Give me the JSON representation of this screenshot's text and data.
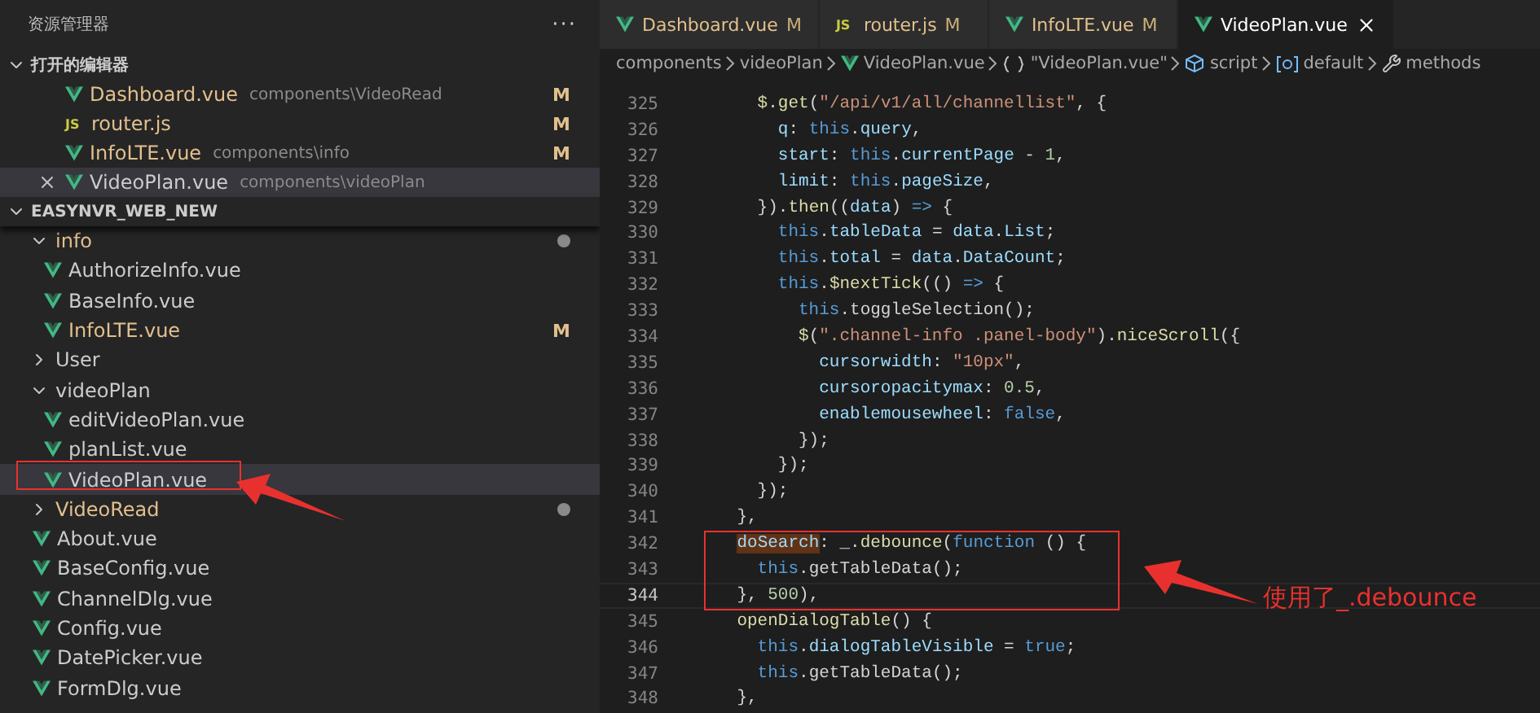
{
  "sidebar": {
    "title": "资源管理器",
    "more": "···",
    "open_editors": {
      "title": "打开的编辑器",
      "expanded": true,
      "items": [
        {
          "name": "Dashboard.vue",
          "path": "components\\VideoRead",
          "kind": "vue",
          "modified": true,
          "badge": "M",
          "active": false
        },
        {
          "name": "router.js",
          "kind": "js",
          "icon_label": "JS",
          "modified": true,
          "badge": "M",
          "active": false
        },
        {
          "name": "InfoLTE.vue",
          "path": "components\\info",
          "kind": "vue",
          "modified": true,
          "badge": "M",
          "active": false
        },
        {
          "name": "VideoPlan.vue",
          "path": "components\\videoPlan",
          "kind": "vue",
          "modified": false,
          "active": true
        }
      ]
    },
    "project": {
      "title": "EASYNVR_WEB_NEW",
      "expanded": true,
      "tree": [
        {
          "kind": "folder",
          "name": "info",
          "expanded": true,
          "changed": true,
          "children": [
            {
              "kind": "file",
              "name": "AuthorizeInfo.vue",
              "modified": false,
              "selected": false
            },
            {
              "kind": "file",
              "name": "BaseInfo.vue",
              "modified": false,
              "selected": false
            },
            {
              "kind": "file",
              "name": "InfoLTE.vue",
              "modified": true,
              "badge": "M",
              "selected": false
            }
          ]
        },
        {
          "kind": "folder",
          "name": "User",
          "expanded": false,
          "changed": false
        },
        {
          "kind": "folder",
          "name": "videoPlan",
          "expanded": true,
          "changed": false,
          "children": [
            {
              "kind": "file",
              "name": "editVideoPlan.vue",
              "modified": false,
              "selected": false
            },
            {
              "kind": "file",
              "name": "planList.vue",
              "modified": false,
              "selected": false
            },
            {
              "kind": "file",
              "name": "VideoPlan.vue",
              "modified": false,
              "selected": true
            }
          ]
        },
        {
          "kind": "folder",
          "name": "VideoRead",
          "expanded": false,
          "changed": true
        },
        {
          "kind": "file",
          "name": "About.vue",
          "modified": false,
          "selected": false
        },
        {
          "kind": "file",
          "name": "BaseConfig.vue",
          "modified": false,
          "selected": false
        },
        {
          "kind": "file",
          "name": "ChannelDlg.vue",
          "modified": false,
          "selected": false
        },
        {
          "kind": "file",
          "name": "Config.vue",
          "modified": false,
          "selected": false
        },
        {
          "kind": "file",
          "name": "DatePicker.vue",
          "modified": false,
          "selected": false
        },
        {
          "kind": "file",
          "name": "FormDlg.vue",
          "modified": false,
          "selected": false
        }
      ]
    }
  },
  "tabs": [
    {
      "label": "Dashboard.vue",
      "kind": "vue",
      "badge": "M",
      "selected": false
    },
    {
      "label": "router.js",
      "kind": "js",
      "icon_label": "JS",
      "badge": "M",
      "selected": false
    },
    {
      "label": "InfoLTE.vue",
      "kind": "vue",
      "badge": "M",
      "selected": false
    },
    {
      "label": "VideoPlan.vue",
      "kind": "vue",
      "selected": true
    }
  ],
  "breadcrumb": [
    {
      "label": "components",
      "kind": "folder"
    },
    {
      "label": "videoPlan",
      "kind": "folder"
    },
    {
      "label": "VideoPlan.vue",
      "kind": "vue"
    },
    {
      "label": "\"VideoPlan.vue\"",
      "kind": "braces"
    },
    {
      "label": "script",
      "kind": "cube"
    },
    {
      "label": "default",
      "kind": "variable"
    },
    {
      "label": "methods",
      "kind": "wrench"
    }
  ],
  "code": [
    {
      "number": "325",
      "current": false,
      "tokens": [
        {
          "kind": "fn",
          "text": "      $"
        },
        {
          "kind": "p",
          "text": "."
        },
        {
          "kind": "fn",
          "text": "get"
        },
        {
          "kind": "p",
          "text": "("
        },
        {
          "kind": "str",
          "text": "\"/api/v1/all/channellist\""
        },
        {
          "kind": "p",
          "text": ", {"
        }
      ]
    },
    {
      "number": "326",
      "current": false,
      "tokens": [
        {
          "kind": "prop",
          "text": "        q"
        },
        {
          "kind": "p",
          "text": ": "
        },
        {
          "kind": "kw",
          "text": "this"
        },
        {
          "kind": "p",
          "text": "."
        },
        {
          "kind": "prop",
          "text": "query"
        },
        {
          "kind": "p",
          "text": ","
        }
      ]
    },
    {
      "number": "327",
      "current": false,
      "tokens": [
        {
          "kind": "prop",
          "text": "        start"
        },
        {
          "kind": "p",
          "text": ": "
        },
        {
          "kind": "kw",
          "text": "this"
        },
        {
          "kind": "p",
          "text": "."
        },
        {
          "kind": "prop",
          "text": "currentPage"
        },
        {
          "kind": "p",
          "text": " - "
        },
        {
          "kind": "num",
          "text": "1"
        },
        {
          "kind": "p",
          "text": ","
        }
      ]
    },
    {
      "number": "328",
      "current": false,
      "tokens": [
        {
          "kind": "prop",
          "text": "        limit"
        },
        {
          "kind": "p",
          "text": ": "
        },
        {
          "kind": "kw",
          "text": "this"
        },
        {
          "kind": "p",
          "text": "."
        },
        {
          "kind": "prop",
          "text": "pageSize"
        },
        {
          "kind": "p",
          "text": ","
        }
      ]
    },
    {
      "number": "329",
      "current": false,
      "tokens": [
        {
          "kind": "p",
          "text": "      })."
        },
        {
          "kind": "fn",
          "text": "then"
        },
        {
          "kind": "p",
          "text": "(("
        },
        {
          "kind": "prop",
          "text": "data"
        },
        {
          "kind": "p",
          "text": ") "
        },
        {
          "kind": "kw",
          "text": "=>"
        },
        {
          "kind": "p",
          "text": " {"
        }
      ]
    },
    {
      "number": "330",
      "current": false,
      "tokens": [
        {
          "kind": "kw",
          "text": "        this"
        },
        {
          "kind": "p",
          "text": "."
        },
        {
          "kind": "prop",
          "text": "tableData"
        },
        {
          "kind": "p",
          "text": " = "
        },
        {
          "kind": "prop",
          "text": "data"
        },
        {
          "kind": "p",
          "text": "."
        },
        {
          "kind": "prop",
          "text": "List"
        },
        {
          "kind": "p",
          "text": ";"
        }
      ]
    },
    {
      "number": "331",
      "current": false,
      "tokens": [
        {
          "kind": "kw",
          "text": "        this"
        },
        {
          "kind": "p",
          "text": "."
        },
        {
          "kind": "prop",
          "text": "total"
        },
        {
          "kind": "p",
          "text": " = "
        },
        {
          "kind": "prop",
          "text": "data"
        },
        {
          "kind": "p",
          "text": "."
        },
        {
          "kind": "prop",
          "text": "DataCount"
        },
        {
          "kind": "p",
          "text": ";"
        }
      ]
    },
    {
      "number": "332",
      "current": false,
      "tokens": [
        {
          "kind": "kw",
          "text": "        this"
        },
        {
          "kind": "p",
          "text": "."
        },
        {
          "kind": "fn",
          "text": "$nextTick"
        },
        {
          "kind": "p",
          "text": "(() "
        },
        {
          "kind": "kw",
          "text": "=>"
        },
        {
          "kind": "p",
          "text": " {"
        }
      ]
    },
    {
      "number": "333",
      "current": false,
      "tokens": [
        {
          "kind": "kw",
          "text": "          this"
        },
        {
          "kind": "p",
          "text": ".toggleSelection"
        },
        {
          "kind": "p",
          "text": "();"
        }
      ]
    },
    {
      "number": "334",
      "current": false,
      "tokens": [
        {
          "kind": "fn",
          "text": "          $"
        },
        {
          "kind": "p",
          "text": "("
        },
        {
          "kind": "str",
          "text": "\".channel-info .panel-body\""
        },
        {
          "kind": "p",
          "text": ")."
        },
        {
          "kind": "fn",
          "text": "niceScroll"
        },
        {
          "kind": "p",
          "text": "({"
        }
      ]
    },
    {
      "number": "335",
      "current": false,
      "tokens": [
        {
          "kind": "prop",
          "text": "            cursorwidth"
        },
        {
          "kind": "p",
          "text": ": "
        },
        {
          "kind": "str",
          "text": "\"10px\""
        },
        {
          "kind": "p",
          "text": ","
        }
      ]
    },
    {
      "number": "336",
      "current": false,
      "tokens": [
        {
          "kind": "prop",
          "text": "            cursoropacitymax"
        },
        {
          "kind": "p",
          "text": ": "
        },
        {
          "kind": "num",
          "text": "0.5"
        },
        {
          "kind": "p",
          "text": ","
        }
      ]
    },
    {
      "number": "337",
      "current": false,
      "tokens": [
        {
          "kind": "prop",
          "text": "            enablemousewheel"
        },
        {
          "kind": "p",
          "text": ": "
        },
        {
          "kind": "kw",
          "text": "false"
        },
        {
          "kind": "p",
          "text": ","
        }
      ]
    },
    {
      "number": "338",
      "current": false,
      "tokens": [
        {
          "kind": "p",
          "text": "          });"
        }
      ]
    },
    {
      "number": "339",
      "current": false,
      "tokens": [
        {
          "kind": "p",
          "text": "        });"
        }
      ]
    },
    {
      "number": "340",
      "current": false,
      "tokens": [
        {
          "kind": "p",
          "text": "      });"
        }
      ]
    },
    {
      "number": "341",
      "current": false,
      "tokens": [
        {
          "kind": "p",
          "text": "    },"
        }
      ]
    },
    {
      "number": "342",
      "current": false,
      "tokens": [
        {
          "kind": "hl",
          "text": "    doSearch"
        },
        {
          "kind": "p",
          "text": ": _."
        },
        {
          "kind": "fn",
          "text": "debounce"
        },
        {
          "kind": "p",
          "text": "("
        },
        {
          "kind": "kw",
          "text": "function"
        },
        {
          "kind": "p",
          "text": " () {"
        }
      ]
    },
    {
      "number": "343",
      "current": false,
      "tokens": [
        {
          "kind": "kw",
          "text": "      this"
        },
        {
          "kind": "p",
          "text": ".getTableData"
        },
        {
          "kind": "p",
          "text": "();"
        }
      ]
    },
    {
      "number": "344",
      "current": true,
      "tokens": [
        {
          "kind": "p",
          "text": "    }, "
        },
        {
          "kind": "num",
          "text": "500"
        },
        {
          "kind": "p",
          "text": "),"
        }
      ]
    },
    {
      "number": "345",
      "current": false,
      "tokens": [
        {
          "kind": "fn",
          "text": "    openDialogTable"
        },
        {
          "kind": "p",
          "text": "() {"
        }
      ]
    },
    {
      "number": "346",
      "current": false,
      "tokens": [
        {
          "kind": "kw",
          "text": "      this"
        },
        {
          "kind": "p",
          "text": "."
        },
        {
          "kind": "prop",
          "text": "dialogTableVisible"
        },
        {
          "kind": "p",
          "text": " = "
        },
        {
          "kind": "kw",
          "text": "true"
        },
        {
          "kind": "p",
          "text": ";"
        }
      ]
    },
    {
      "number": "347",
      "current": false,
      "tokens": [
        {
          "kind": "kw",
          "text": "      this"
        },
        {
          "kind": "p",
          "text": ".getTableData"
        },
        {
          "kind": "p",
          "text": "();"
        }
      ]
    },
    {
      "number": "348",
      "current": false,
      "tokens": [
        {
          "kind": "p",
          "text": "    },"
        }
      ]
    }
  ],
  "annotation": {
    "text": "使用了_.debounce"
  }
}
